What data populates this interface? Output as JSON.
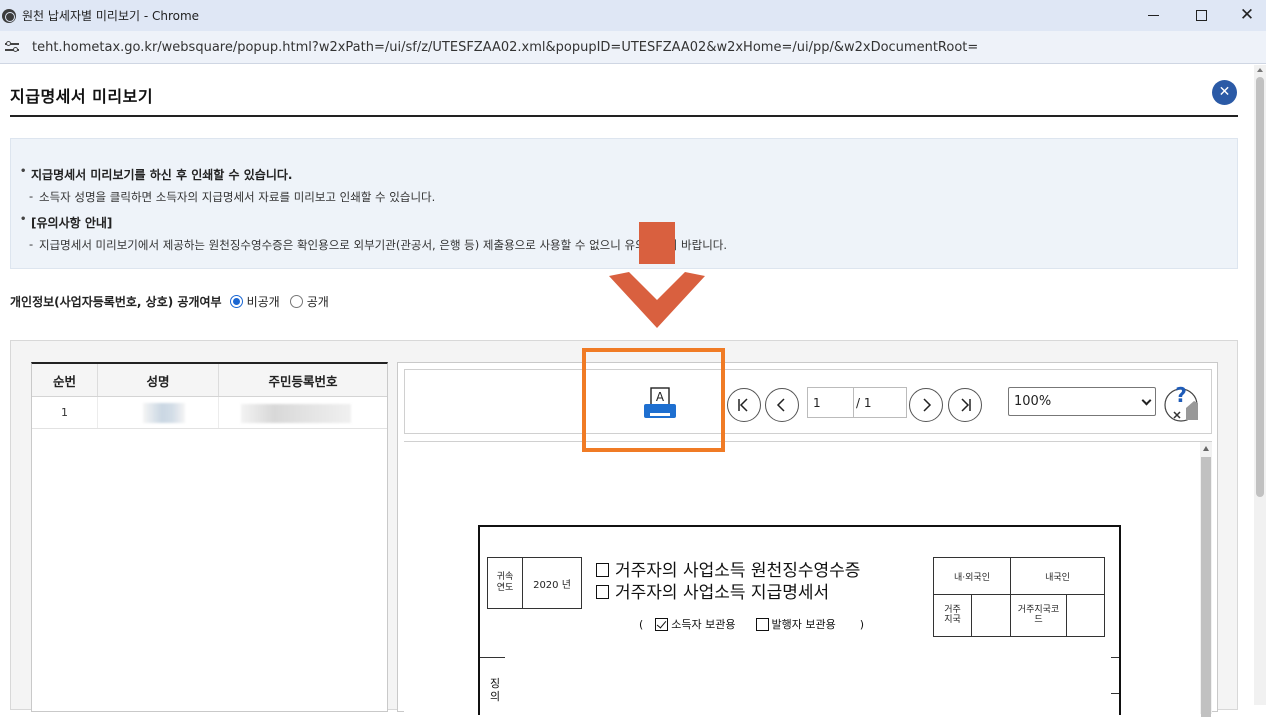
{
  "window": {
    "title": "원천 납세자별 미리보기 - Chrome",
    "url": "teht.hometax.go.kr/websquare/popup.html?w2xPath=/ui/sf/z/UTESFZAA02.xml&popupID=UTESFZAA02&w2xHome=/ui/pp/&w2xDocumentRoot="
  },
  "page": {
    "title": "지급명세서 미리보기",
    "close_label": "✕"
  },
  "notice": {
    "h1": "지급명세서 미리보기를 하신 후 인쇄할 수 있습니다.",
    "d1": "소득자 성명을 클릭하면 소득자의 지급명세서 자료를 미리보고 인쇄할 수 있습니다.",
    "h2": "[유의사항 안내]",
    "d2": "지급명세서 미리보기에서 제공하는 원천징수영수증은 확인용으로 외부기관(관공서, 은행 등) 제출용으로 사용할 수 없으니 유의하시기 바랍니다."
  },
  "privacy": {
    "label": "개인정보(사업자등록번호, 상호) 공개여부",
    "options": [
      "비공개",
      "공개"
    ],
    "selected": "비공개"
  },
  "list": {
    "headers": [
      "순번",
      "성명",
      "주민등록번호"
    ],
    "rows": [
      {
        "no": "1",
        "name": "",
        "rrn": ""
      }
    ]
  },
  "viewer": {
    "print_icon_glyph": "A",
    "current_page": "1",
    "total_pages": "/ 1",
    "zoom": "100%",
    "help_glyph": "?",
    "nav": {
      "first": "|<",
      "prev": "<",
      "next": ">",
      "last": ">|"
    }
  },
  "document": {
    "year_label": "귀속\n연도",
    "year_value": "2020 년",
    "title1": "거주자의 사업소득 원천징수영수증",
    "title2": "거주자의 사업소득 지급명세서",
    "paren_open": "(",
    "paren_close": ")",
    "copy_income": "소득자 보관용",
    "copy_payer": "발행자 보관용",
    "nationality_label": "내·외국인",
    "nationality_value": "내국인",
    "residence_label": "거주\n지국",
    "residence_code_label": "거주지국코\n드",
    "side_label": "징\n의"
  },
  "colors": {
    "accent": "#f07b25",
    "arrow": "#d9603f",
    "close_button": "#2b5aa6",
    "radio": "#1a66d2",
    "print_icon": "#1e6fd0"
  }
}
